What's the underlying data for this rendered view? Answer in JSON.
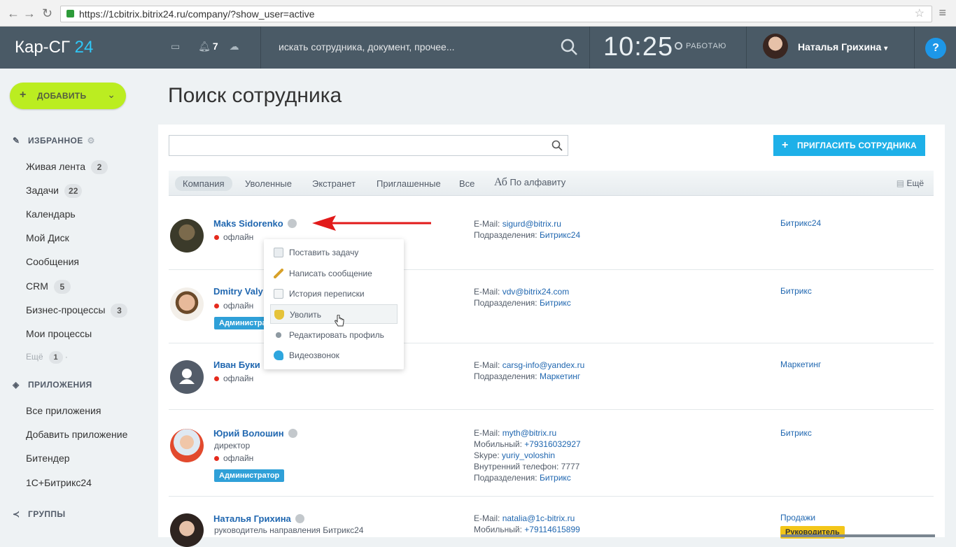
{
  "browser": {
    "url": "https://1cbitrix.bitrix24.ru/company/?show_user=active"
  },
  "topbar": {
    "logo_main": "Кар-СГ ",
    "logo_accent": "24",
    "notif_count": "7",
    "search_placeholder": "искать сотрудника, документ, прочее...",
    "clock": "10:25",
    "work_status": "РАБОТАЮ",
    "user_name": "Наталья Грихина",
    "help": "?"
  },
  "sidebar": {
    "add_button": "ДОБАВИТЬ",
    "favorites_title": "ИЗБРАННОЕ",
    "favorites": [
      {
        "label": "Живая лента",
        "count": "2"
      },
      {
        "label": "Задачи",
        "count": "22"
      },
      {
        "label": "Календарь",
        "count": ""
      },
      {
        "label": "Мой Диск",
        "count": ""
      },
      {
        "label": "Сообщения",
        "count": ""
      },
      {
        "label": "CRM",
        "count": "5"
      },
      {
        "label": "Бизнес-процессы",
        "count": "3"
      },
      {
        "label": "Мои процессы",
        "count": ""
      }
    ],
    "more_label": "Ещё",
    "more_count": "1",
    "apps_title": "ПРИЛОЖЕНИЯ",
    "apps": [
      "Все приложения",
      "Добавить приложение",
      "Битендер",
      "1С+Битрикс24"
    ],
    "groups_title": "ГРУППЫ"
  },
  "page": {
    "title": "Поиск сотрудника",
    "invite_button": "ПРИГЛАСИТЬ СОТРУДНИКА",
    "filters": [
      "Компания",
      "Уволенные",
      "Экстранет",
      "Приглашенные",
      "Все"
    ],
    "alpha_icon": "Аб",
    "alpha_label": "По алфавиту",
    "more_label": "Ещё"
  },
  "employees": [
    {
      "name": "Maks Sidorenko",
      "post": "",
      "status": "офлайн",
      "badge": "",
      "info": [
        [
          "E-Mail:",
          "sigurd@bitrix.ru"
        ],
        [
          "Подразделения:",
          "Битрикс24"
        ]
      ],
      "dept": "Битрикс24",
      "dept_badge": ""
    },
    {
      "name": "Dmitry Valy",
      "post": "",
      "status": "офлайн",
      "badge": "Администратор",
      "info": [
        [
          "E-Mail:",
          "vdv@bitrix24.com"
        ],
        [
          "Подразделения:",
          "Битрикс"
        ]
      ],
      "dept": "Битрикс",
      "dept_badge": ""
    },
    {
      "name": "Иван Буки",
      "post": "",
      "status": "офлайн",
      "badge": "",
      "info": [
        [
          "E-Mail:",
          "carsg-info@yandex.ru"
        ],
        [
          "Подразделения:",
          "Маркетинг"
        ]
      ],
      "dept": "Маркетинг",
      "dept_badge": ""
    },
    {
      "name": "Юрий Волошин",
      "post": "директор",
      "status": "офлайн",
      "badge": "Администратор",
      "info": [
        [
          "E-Mail:",
          "myth@bitrix.ru"
        ],
        [
          "Мобильный:",
          "+79316032927"
        ],
        [
          "Skype:",
          "yuriy_voloshin"
        ],
        [
          "Внутренний телефон: 7777",
          ""
        ],
        [
          "Подразделения:",
          "Битрикс"
        ]
      ],
      "dept": "Битрикс",
      "dept_badge": ""
    },
    {
      "name": "Наталья Грихина",
      "post": "руководитель направления Битрикс24",
      "status": "",
      "badge": "",
      "info": [
        [
          "E-Mail:",
          "natalia@1c-bitrix.ru"
        ],
        [
          "Мобильный:",
          "+79114615899"
        ]
      ],
      "dept": "Продажи",
      "dept_badge": "Руководитель"
    }
  ],
  "context_menu": [
    {
      "label": "Поставить задачу",
      "icon": "task-icon"
    },
    {
      "label": "Написать сообщение",
      "icon": "pencil-icon"
    },
    {
      "label": "История переписки",
      "icon": "history-icon"
    },
    {
      "label": "Уволить",
      "icon": "shield-icon"
    },
    {
      "label": "Редактировать профиль",
      "icon": "edit-profile-icon"
    },
    {
      "label": "Видеозвонок",
      "icon": "video-call-icon"
    }
  ],
  "colors": {
    "accent": "#1eb0e8",
    "add": "#bbed21",
    "topbar": "#4a5a66",
    "offline": "#e52a1d"
  }
}
